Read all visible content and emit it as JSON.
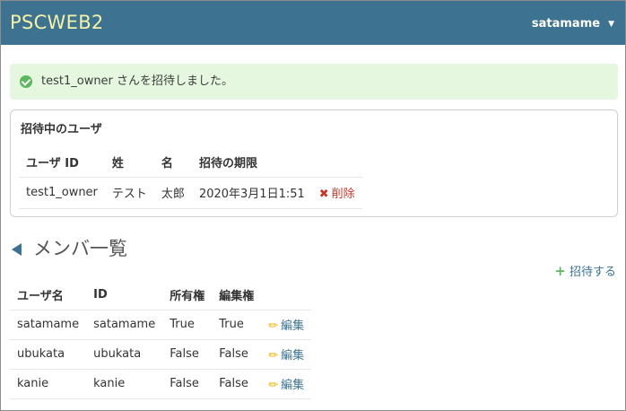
{
  "navbar": {
    "brand": "PSCWEB2",
    "username": "satamame",
    "caret": "▼"
  },
  "alert": {
    "icon": "check-circle-icon",
    "message": "test1_owner さんを招待しました。",
    "color": "#e5f8df"
  },
  "invitations": {
    "title": "招待中のユーザ",
    "headers": [
      "ユーザ ID",
      "姓",
      "名",
      "招待の期限"
    ],
    "rows": [
      {
        "user_id": "test1_owner",
        "last_name": "テスト",
        "first_name": "太郎",
        "expires": "2020年3月1日1:51",
        "delete_label": "削除"
      }
    ]
  },
  "members": {
    "title": "メンバ一覧",
    "invite_label": "招待する",
    "headers": [
      "ユーザ名",
      "ID",
      "所有権",
      "編集権"
    ],
    "rows": [
      {
        "username": "satamame",
        "id": "satamame",
        "owner": "True",
        "editor": "True",
        "edit_label": "編集"
      },
      {
        "username": "ubukata",
        "id": "ubukata",
        "owner": "False",
        "editor": "False",
        "edit_label": "編集"
      },
      {
        "username": "kanie",
        "id": "kanie",
        "owner": "False",
        "editor": "False",
        "edit_label": "編集"
      }
    ]
  },
  "colors": {
    "navbar": "#3d7391",
    "brand": "#f4f1a8",
    "success": "#5cb85c",
    "danger": "#c0392b",
    "link": "#3d7391"
  }
}
